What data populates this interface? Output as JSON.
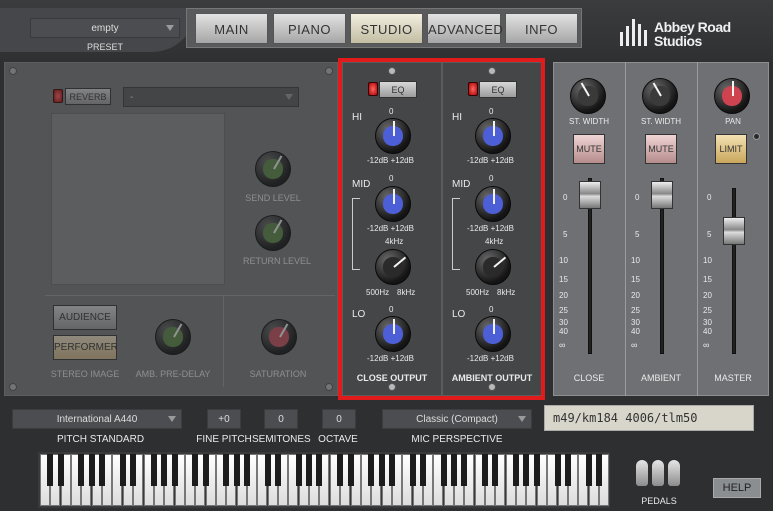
{
  "preset": {
    "value": "empty",
    "label": "PRESET"
  },
  "tabs": [
    {
      "label": "MAIN",
      "active": false
    },
    {
      "label": "PIANO",
      "active": false
    },
    {
      "label": "STUDIO",
      "active": true
    },
    {
      "label": "ADVANCED",
      "active": false
    },
    {
      "label": "INFO",
      "active": false
    }
  ],
  "brand": {
    "line1": "Abbey Road",
    "line2": "Studios"
  },
  "reverb": {
    "button_label": "REVERB",
    "select_value": "-",
    "send_level": "SEND LEVEL",
    "return_level": "RETURN LEVEL",
    "audience": "AUDIENCE",
    "performer": "PERFORMER",
    "stereo_image": "STEREO IMAGE",
    "amb_pre_delay": "AMB. PRE-DELAY",
    "saturation": "SATURATION"
  },
  "eq_channels": [
    {
      "eq_label": "EQ",
      "hi": "HI",
      "mid": "MID",
      "lo": "LO",
      "zero": "0",
      "minus": "-12dB",
      "plus": "+12dB",
      "freq_top": "4kHz",
      "freq_left": "500Hz",
      "freq_right": "8kHz",
      "output": "CLOSE OUTPUT"
    },
    {
      "eq_label": "EQ",
      "hi": "HI",
      "mid": "MID",
      "lo": "LO",
      "zero": "0",
      "minus": "-12dB",
      "plus": "+12dB",
      "freq_top": "4kHz",
      "freq_left": "500Hz",
      "freq_right": "8kHz",
      "output": "AMBIENT OUTPUT"
    }
  ],
  "mixer": {
    "channels": [
      {
        "top_label": "ST. WIDTH",
        "button": "MUTE",
        "name": "CLOSE"
      },
      {
        "top_label": "ST. WIDTH",
        "button": "MUTE",
        "name": "AMBIENT"
      },
      {
        "top_label": "PAN",
        "button": "LIMIT",
        "name": "MASTER"
      }
    ],
    "scale": [
      "0",
      "5",
      "10",
      "15",
      "20",
      "25",
      "30",
      "40",
      "∞"
    ]
  },
  "bottom": {
    "pitch_standard": {
      "value": "International  A440",
      "label": "PITCH STANDARD"
    },
    "fine_pitch": {
      "value": "+0",
      "label": "FINE PITCH"
    },
    "semitones": {
      "value": "0",
      "label": "SEMITONES"
    },
    "octave": {
      "value": "0",
      "label": "OCTAVE"
    },
    "mic_perspective": {
      "value": "Classic (Compact)",
      "label": "MIC PERSPECTIVE"
    },
    "mic_note": "m49/km184 4006/tlm50",
    "pedals": "PEDALS",
    "help": "HELP"
  },
  "colors": {
    "highlight": "#e11b1b",
    "eq_cap": "#4d5fd6",
    "pan_cap": "#cf4250",
    "send_cap": "#5c8a45",
    "sat_cap": "#c85060"
  }
}
